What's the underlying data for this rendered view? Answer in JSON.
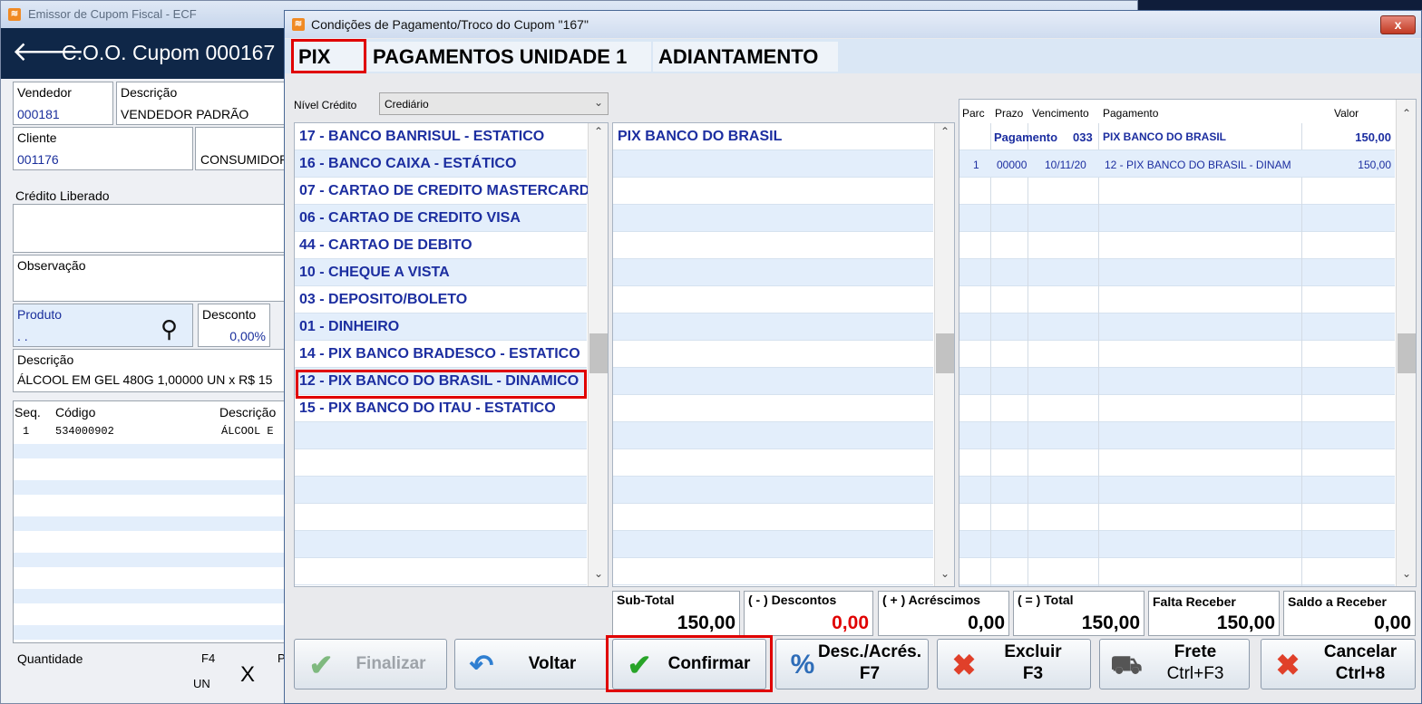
{
  "background_window": {
    "title": "Emissor de Cupom Fiscal - ECF",
    "header_title": "C.O.O. Cupom  000167",
    "vendedor_label": "Vendedor",
    "vendedor_value": "000181",
    "descricao_label": "Descrição",
    "descricao_value": "VENDEDOR PADRÃO",
    "cliente_label": "Cliente",
    "cliente_value": "001176",
    "cliente_name": "CONSUMIDOR",
    "credito_label": "Crédito Liberado",
    "observacao_label": "Observação",
    "produto_label": "Produto",
    "produto_value": ". .",
    "desconto_label": "Desconto",
    "desconto_value": "0,00%",
    "descricao2_label": "Descrição",
    "descricao2_value": "ÁLCOOL EM GEL 480G 1,00000 UN x R$ 15",
    "grid_headers": [
      "Seq.",
      "Código",
      "Descrição"
    ],
    "grid_row": {
      "seq": "1",
      "codigo": "534000902",
      "descricao": "ÁLCOOL E"
    },
    "quantidade_label": "Quantidade",
    "f4_label": "F4",
    "p_label": "P",
    "x_label": "X",
    "un_label": "UN"
  },
  "modal": {
    "title": "Condições de Pagamento/Troco do Cupom \"167\"",
    "close_label": "x",
    "tabs": [
      "PIX",
      "PAGAMENTOS UNIDADE 1",
      "ADIANTAMENTO"
    ],
    "nivel_credito_label": "Nível Crédito",
    "nivel_credito_value": "Crediário",
    "payment_methods": [
      "17 - BANCO BANRISUL - ESTATICO",
      "16 - BANCO CAIXA - ESTÁTICO",
      "07 - CARTAO DE CREDITO MASTERCARD",
      "06 - CARTAO DE CREDITO VISA",
      "44 - CARTAO DE DEBITO",
      "10 - CHEQUE A VISTA",
      "03 - DEPOSITO/BOLETO",
      "01 - DINHEIRO",
      "14 - PIX BANCO BRADESCO - ESTATICO",
      "12 - PIX BANCO DO BRASIL - DINAMICO",
      "15 - PIX BANCO DO ITAU - ESTATICO"
    ],
    "middle_list": [
      "PIX BANCO DO BRASIL"
    ],
    "table_headers": {
      "parc": "Parc",
      "prazo": "Prazo",
      "vencimento": "Vencimento",
      "pagamento": "Pagamento",
      "valor": "Valor"
    },
    "table_group": {
      "label": "Pagamento",
      "code": "033",
      "name": "PIX BANCO DO BRASIL",
      "valor": "150,00"
    },
    "table_rows": [
      {
        "parc": "1",
        "prazo": "00000",
        "vencimento": "10/11/20",
        "pagamento": "12 - PIX BANCO DO BRASIL - DINAM",
        "valor": "150,00"
      }
    ],
    "totals": {
      "subtotal_label": "Sub-Total",
      "subtotal_value": "150,00",
      "descontos_label": "( - ) Descontos",
      "descontos_value": "0,00",
      "acrescimos_label": "( + ) Acréscimos",
      "acrescimos_value": "0,00",
      "total_label": "( = ) Total",
      "total_value": "150,00",
      "falta_label": "Falta Receber",
      "falta_value": "150,00",
      "saldo_label": "Saldo a Receber",
      "saldo_value": "0,00"
    },
    "buttons": {
      "finalizar": "Finalizar",
      "voltar": "Voltar",
      "confirmar": "Confirmar",
      "desc_line1": "Desc./Acrés.",
      "desc_line2": "F7",
      "excluir_line1": "Excluir",
      "excluir_line2": "F3",
      "frete_line1": "Frete",
      "frete_line2": "Ctrl+F3",
      "cancelar_line1": "Cancelar",
      "cancelar_line2": "Ctrl+8"
    }
  },
  "colors": {
    "header_dark": "#0f2748",
    "list_text": "#1c2ea0",
    "alt_row": "#e3eefb",
    "highlight_red": "#e00000",
    "descontos_red": "#e00000"
  }
}
